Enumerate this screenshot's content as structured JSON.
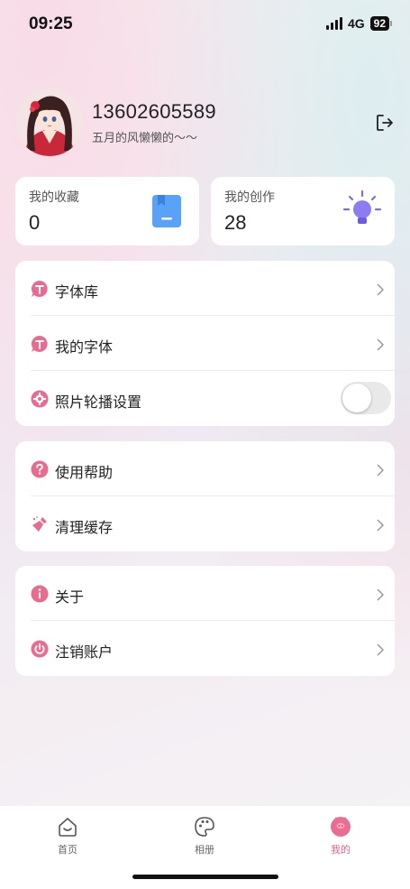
{
  "status": {
    "time": "09:25",
    "network": "4G",
    "battery": "92"
  },
  "profile": {
    "phone": "13602605589",
    "motto": "五月的风懒懒的～～",
    "avatar_icon": "avatar-anime-girl",
    "logout_icon": "logout-icon"
  },
  "stats": {
    "favorites": {
      "label": "我的收藏",
      "value": "0",
      "icon": "bookmark-icon",
      "color": "#4c97f5"
    },
    "creations": {
      "label": "我的创作",
      "value": "28",
      "icon": "lightbulb-icon",
      "color": "#8b7cf2"
    }
  },
  "groups": {
    "fonts": {
      "items": [
        {
          "label": "字体库",
          "icon": "font-t-icon"
        },
        {
          "label": "我的字体",
          "icon": "font-t-icon"
        },
        {
          "label": "照片轮播设置",
          "icon": "gear-icon",
          "toggle": false
        }
      ]
    },
    "support": {
      "items": [
        {
          "label": "使用帮助",
          "icon": "help-icon"
        },
        {
          "label": "清理缓存",
          "icon": "broom-icon"
        }
      ]
    },
    "account": {
      "items": [
        {
          "label": "关于",
          "icon": "info-icon"
        },
        {
          "label": "注销账户",
          "icon": "power-icon"
        }
      ]
    }
  },
  "tabs": [
    {
      "label": "首页",
      "icon": "home-face-icon",
      "active": false
    },
    {
      "label": "相册",
      "icon": "palette-icon",
      "active": false
    },
    {
      "label": "我的",
      "icon": "pig-face-icon",
      "active": true
    }
  ],
  "colors": {
    "accent": "#e8608a",
    "card": "#ffffff"
  }
}
